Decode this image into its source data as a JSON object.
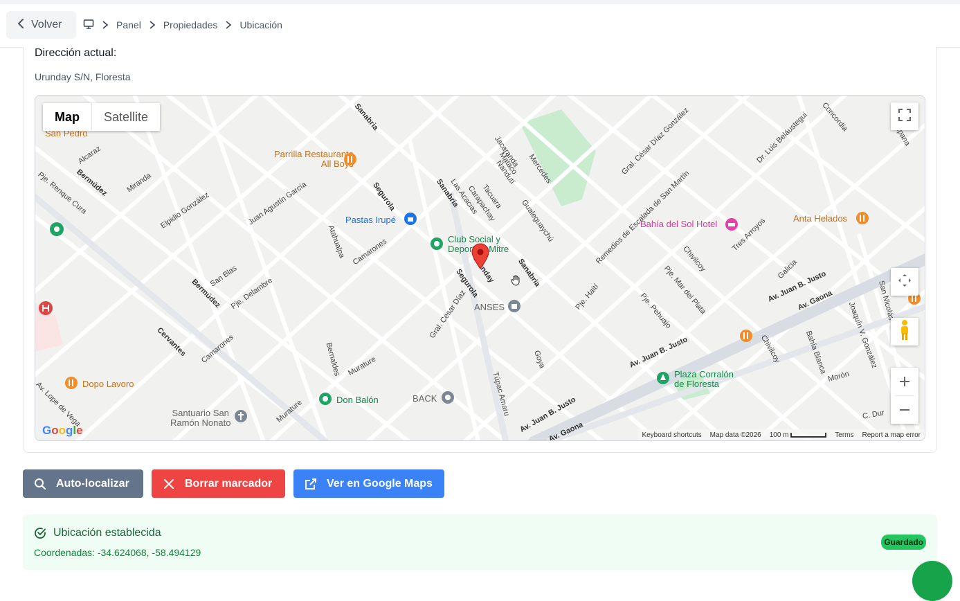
{
  "header": {
    "back_label": "Volver",
    "breadcrumbs": [
      "Panel",
      "Propiedades",
      "Ubicación"
    ]
  },
  "address": {
    "title": "Dirección actual:",
    "value": "Urunday S/N, Floresta"
  },
  "map": {
    "type_map": "Map",
    "type_satellite": "Satellite",
    "footer": {
      "shortcuts": "Keyboard shortcuts",
      "data": "Map data ©2026",
      "scale": "100 m",
      "terms": "Terms",
      "report": "Report a map error"
    },
    "logo": "Google",
    "pois": {
      "parrilla": "Parrilla Restaurante\nAll Boys",
      "pastas": "Pastas Irupé",
      "club": "Club Social y\nDeportivo Mitre",
      "bahia": "Bahía del Sol Hotel",
      "anta": "Anta Helados",
      "anses": "ANSES",
      "plaza": "Plaza Corralón\nde Floresta",
      "dopo": "Dopo Lavoro",
      "donbalon": "Don Balón",
      "back": "BACK",
      "santuario": "Santuario San\nRamón Nonato",
      "sanpedro": "San Pedro"
    },
    "streets": {
      "segurola1": "Segurola",
      "segurola2": "Segurola",
      "sanabria1": "Sanabria",
      "sanabria2": "Sanabria",
      "sanabria3": "Sanabria",
      "bermudez1": "Bermúdez",
      "bermudez2": "Bermúdez",
      "cervantes": "Cervantes",
      "urunday": "Urunday",
      "juanbjusto1": "Av. Juan B. Justo",
      "juanbjusto2": "Av. Juan B. Justo",
      "juanbjusto3": "Av. Juan B. Justo",
      "gaona": "Av. Gaona",
      "gaona2": "Av. Gaona",
      "alcaraz": "Alcaraz",
      "miranda": "Miranda",
      "renque": "Pje. Renque Cura",
      "elpidio": "Elpidio González",
      "juanagustin": "Juan Agustín García",
      "atahualpa": "Atahualpa",
      "camarones1": "Camarones",
      "camarones2": "Camarones",
      "sanblas": "San Blas",
      "delambre": "Pje. Delambre",
      "bernaldes": "Bernaldes",
      "murature1": "Murature",
      "murature2": "Murature",
      "cesar1": "Gral. César Díaz",
      "cesar2": "Gral. César Díaz González",
      "lasacacias": "Las Acacias",
      "carapachay": "Carapachay",
      "tacuara": "Tacuara",
      "gualeguaychu": "Gualeguaychú",
      "jacaranda": "Jacaranda",
      "mataco": "Mataco",
      "nandutí": "Ñandutí",
      "mercedes": "Mercedes",
      "remedios": "Remedios de Escalada de San Martín",
      "tresarroyos": "Tres Arroyos",
      "chivilcoy1": "Chivilcoy",
      "chivilcoy2": "Chivilcoy",
      "pjemar": "Pje. Mar del Plata",
      "pjehaiti": "Pje. Haití",
      "pjepehuajo": "Pje. Pehuajo",
      "galicia": "Galicia",
      "bahiablanca": "Bahía Blanca",
      "joaquin": "Joaquín V. González",
      "moron": "Morón",
      "goya": "Goya",
      "tupac": "Túpac Amaru",
      "dr": "Dr. Luis Beláustegui",
      "concordia": "Concordia",
      "campana": "Campana",
      "sannicolas": "San Nicolás",
      "lope": "Av. Lope de Vega",
      "cdur": "C. Dur"
    }
  },
  "actions": {
    "autolocate": "Auto-localizar",
    "clear": "Borrar marcador",
    "gmaps": "Ver en Google Maps"
  },
  "status": {
    "title": "Ubicación establecida",
    "coords": "Coordenadas: -34.624068, -58.494129",
    "badge": "Guardado"
  },
  "colors": {
    "primary_gray": "#64748b",
    "danger": "#ef4444",
    "info": "#3b82f6",
    "success_bg": "#f0fdf4",
    "success": "#22c55e"
  }
}
